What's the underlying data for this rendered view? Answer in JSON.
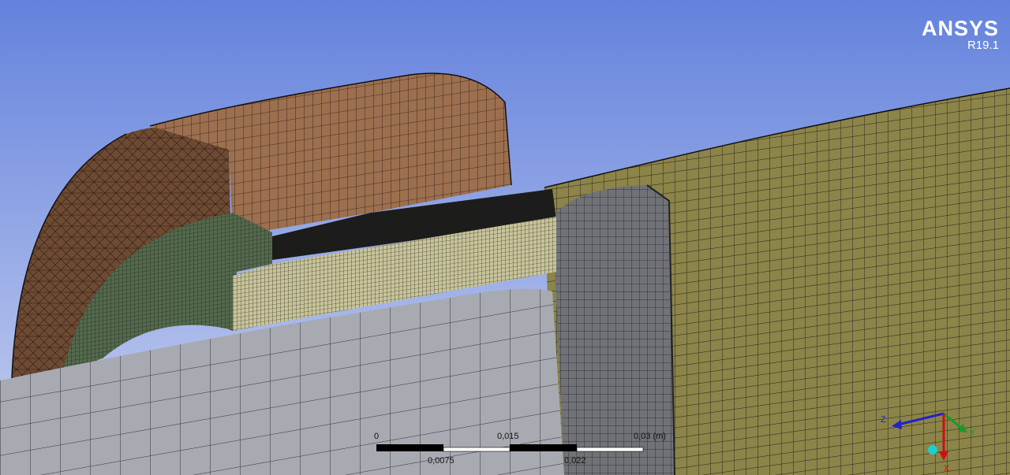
{
  "app": {
    "logo_brand": "ANSYS",
    "logo_version": "R19.1"
  },
  "scale_bar": {
    "labels_top": [
      "0",
      "0,015",
      "0,03 (m)"
    ],
    "labels_bottom": [
      "0,0075",
      "0,022"
    ]
  },
  "triad": {
    "axes": [
      "Z",
      "Y",
      "X"
    ],
    "colors": {
      "z": "#2222cc",
      "y": "#1a9a2a",
      "x": "#cc1111",
      "origin": "#22cccc"
    }
  },
  "colors": {
    "background_top": "#6482dd",
    "background_bottom": "#c6d0ef",
    "copper": "#9c6f4f",
    "copper_dark": "#6e4a33",
    "olive": "#8c8448",
    "grey_block": "#a7aab1",
    "dark_grey": "#707277",
    "insulation": "#c7c49b",
    "green_core": "#53694d"
  }
}
